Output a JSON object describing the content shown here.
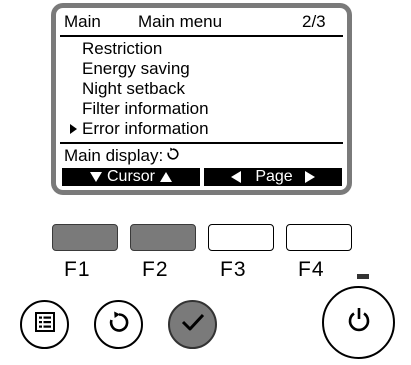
{
  "lcd": {
    "header": {
      "left": "Main",
      "title": "Main menu",
      "page": "2/3"
    },
    "menu_items": [
      {
        "label": "Restriction",
        "selected": false
      },
      {
        "label": "Energy saving",
        "selected": false
      },
      {
        "label": "Night setback",
        "selected": false
      },
      {
        "label": "Filter information",
        "selected": false
      },
      {
        "label": "Error information",
        "selected": true
      }
    ],
    "status": {
      "label": "Main display:",
      "icon": "return-icon"
    },
    "function_bar": {
      "left_label": "Cursor",
      "right_label": "Page"
    }
  },
  "function_keys": [
    {
      "label": "F1",
      "pressed": true
    },
    {
      "label": "F2",
      "pressed": true
    },
    {
      "label": "F3",
      "pressed": false
    },
    {
      "label": "F4",
      "pressed": false
    }
  ],
  "buttons": {
    "menu": {
      "icon": "menu-icon"
    },
    "return": {
      "icon": "return-icon"
    },
    "select": {
      "icon": "check-icon",
      "pressed": true
    },
    "power": {
      "icon": "power-icon"
    }
  },
  "colors": {
    "pressed_key": "#7a7a7a",
    "lcd_frame": "#7a7a7a",
    "lcd_background": "#ffffff"
  }
}
